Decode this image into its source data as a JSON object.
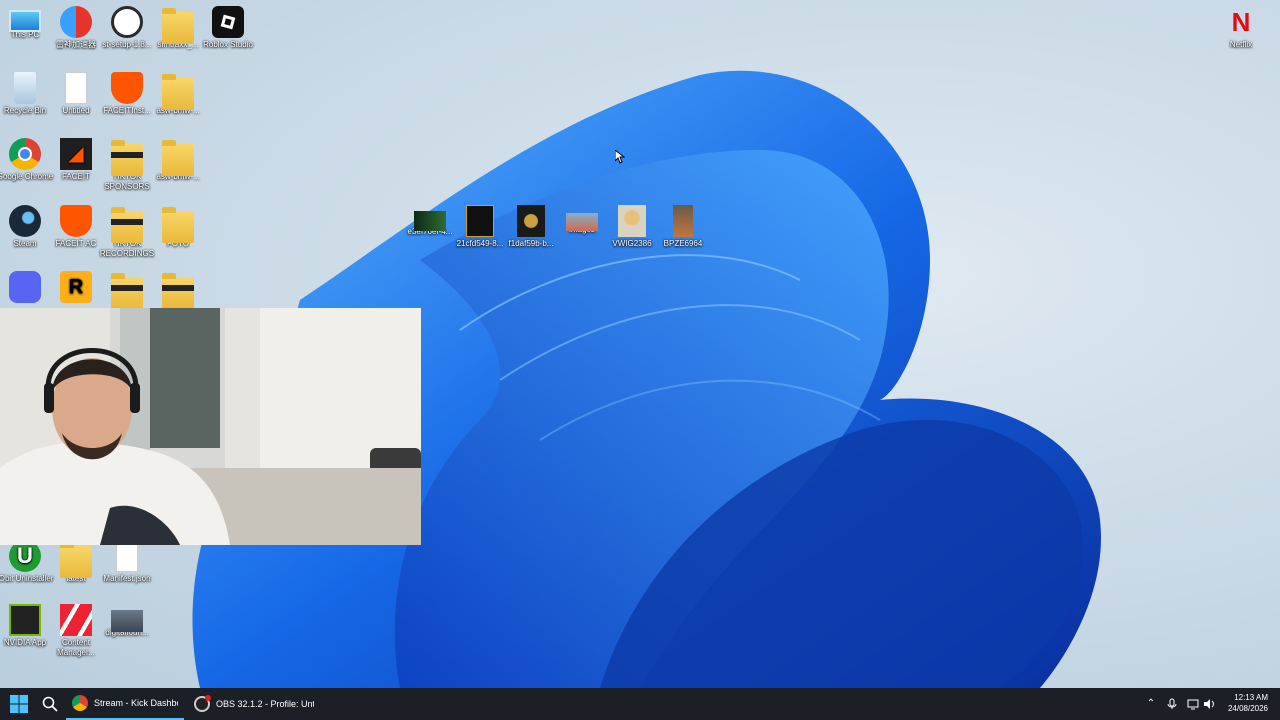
{
  "desktop": {
    "icons": [
      {
        "label": "This PC"
      },
      {
        "label": "雷神加速器"
      },
      {
        "label": "st-setup-1.8..."
      },
      {
        "label": "simtraxx_..."
      },
      {
        "label": "Roblox Studio"
      },
      {
        "label": "Recycle Bin"
      },
      {
        "label": "Untitled"
      },
      {
        "label": "FACEITInst..."
      },
      {
        "label": "asw-bmw-..."
      },
      {
        "label": "Google Chrome"
      },
      {
        "label": "FACEIT"
      },
      {
        "label": "TIKTOK SPONSORS"
      },
      {
        "label": "asw-bmw-..."
      },
      {
        "label": "Steam"
      },
      {
        "label": "FACEIT AC"
      },
      {
        "label": "TIKTOK RECORDINGS"
      },
      {
        "label": "FOTO"
      },
      {
        "label": "Discord"
      },
      {
        "label": "Rockstar Games Launcher"
      },
      {
        "label": ""
      },
      {
        "label": ""
      },
      {
        "label": "IObit Uninstaller"
      },
      {
        "label": "latest"
      },
      {
        "label": "Manifest.json"
      },
      {
        "label": "NVIDIA App"
      },
      {
        "label": "Content Manager..."
      },
      {
        "label": "digitalfoun..."
      },
      {
        "label": "Netflix"
      }
    ],
    "center_icons": [
      {
        "label": "e3ef76ef-4..."
      },
      {
        "label": "21cfd549-8..."
      },
      {
        "label": "f1daf59b-b..."
      },
      {
        "label": "images"
      },
      {
        "label": "VWIG2386"
      },
      {
        "label": "BPZE6964"
      }
    ]
  },
  "taskbar": {
    "apps": [
      {
        "label": "Stream - Kick Dashboar"
      },
      {
        "label": "OBS 32.1.2 - Profile: Unt"
      }
    ],
    "clock": {
      "time": "12:13 AM",
      "date": "24/08/2026"
    }
  },
  "colors": {
    "accent": "#1a73e8",
    "taskbar": "#1c1f26",
    "netflix": "#e50914"
  }
}
